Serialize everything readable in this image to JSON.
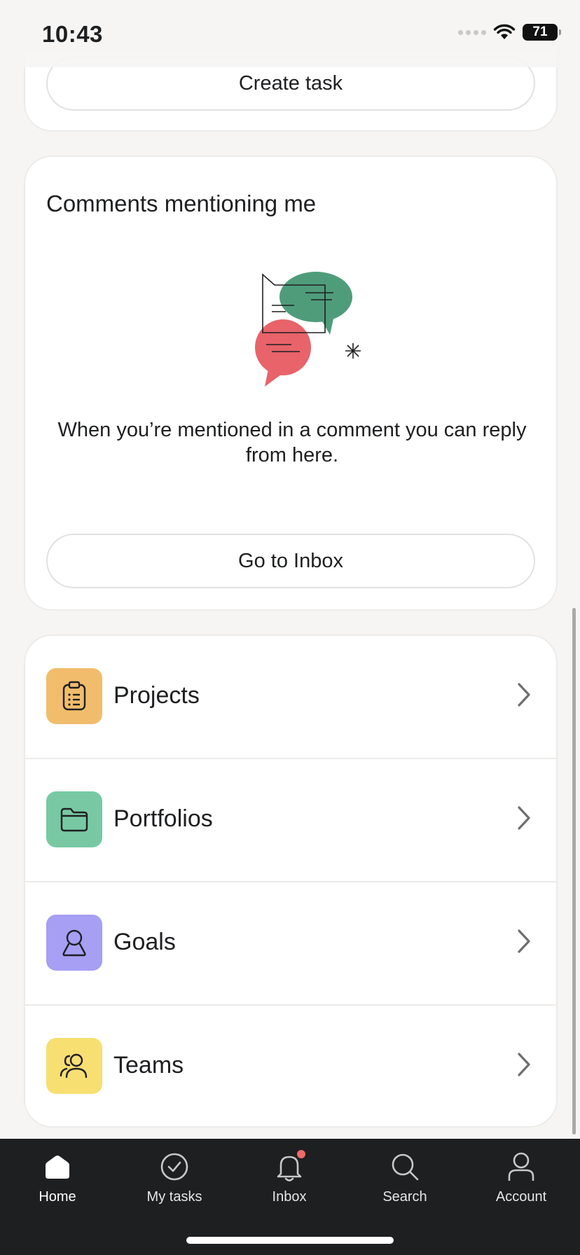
{
  "status_bar": {
    "time": "10:43",
    "battery": "71"
  },
  "tasks_card": {
    "create_task_label": "Create task"
  },
  "mentions_card": {
    "title": "Comments mentioning me",
    "empty_message": "When you’re mentioned in a comment you can reply from here.",
    "inbox_button_label": "Go to Inbox"
  },
  "nav_list": {
    "items": [
      {
        "label": "Projects",
        "icon": "clipboard-icon",
        "color": "#f1bd6c"
      },
      {
        "label": "Portfolios",
        "icon": "folder-icon",
        "color": "#78c9a3"
      },
      {
        "label": "Goals",
        "icon": "person-goal-icon",
        "color": "#a69ff3"
      },
      {
        "label": "Teams",
        "icon": "people-icon",
        "color": "#f8df72"
      }
    ]
  },
  "tab_bar": {
    "tabs": [
      {
        "label": "Home",
        "icon": "home-icon",
        "active": true
      },
      {
        "label": "My tasks",
        "icon": "check-circle-icon",
        "active": false
      },
      {
        "label": "Inbox",
        "icon": "bell-icon",
        "active": false,
        "has_notification": true
      },
      {
        "label": "Search",
        "icon": "search-icon",
        "active": false
      },
      {
        "label": "Account",
        "icon": "account-icon",
        "active": false
      }
    ]
  },
  "colors": {
    "background": "#f6f5f4",
    "card": "#ffffff",
    "tab_bar": "#1e1f21",
    "notification": "#f06a6a",
    "illustration_green": "#4f9c7b",
    "illustration_red": "#e8636a"
  }
}
